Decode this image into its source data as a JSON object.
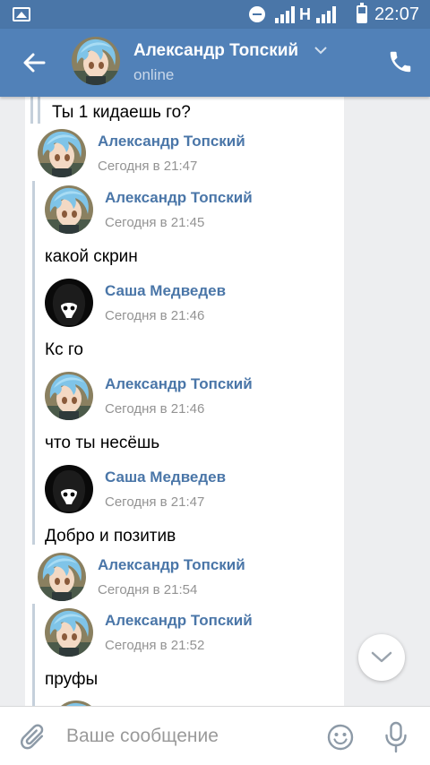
{
  "status_bar": {
    "network_type": "H",
    "time": "22:07"
  },
  "header": {
    "contact_name": "Александр Топский",
    "status": "online"
  },
  "messages": [
    {
      "text": "Ты 1 кидаешь го?"
    },
    {
      "name": "Александр Топский",
      "time": "Сегодня в 21:47",
      "avatar": "anime-blue-hair"
    },
    {
      "name": "Александр Топский",
      "time": "Сегодня в 21:45",
      "text": "какой скрин",
      "avatar": "anime-blue-hair"
    },
    {
      "name": "Саша Медведев",
      "time": "Сегодня в 21:46",
      "text": "Кс го",
      "avatar": "dark-hooded"
    },
    {
      "name": "Александр Топский",
      "time": "Сегодня в 21:46",
      "text": "что ты несёшь",
      "avatar": "anime-blue-hair"
    },
    {
      "name": "Саша Медведев",
      "time": "Сегодня в 21:47",
      "text": "Добро и позитив",
      "avatar": "dark-hooded"
    },
    {
      "name": "Александр Топский",
      "time": "Сегодня в 21:54",
      "avatar": "anime-blue-hair"
    },
    {
      "name": "Александр Топский",
      "time": "Сегодня в 21:52",
      "text": "пруфы",
      "avatar": "anime-blue-hair"
    }
  ],
  "composer": {
    "placeholder": "Ваше сообщение"
  },
  "colors": {
    "status_bar": "#4a76a8",
    "header": "#5181b8",
    "name_link": "#4a76a8",
    "background": "#edeef0"
  },
  "icons": [
    "back-arrow-icon",
    "chevron-down-icon",
    "phone-icon",
    "paperclip-icon",
    "emoji-icon",
    "microphone-icon",
    "scroll-down-icon"
  ]
}
